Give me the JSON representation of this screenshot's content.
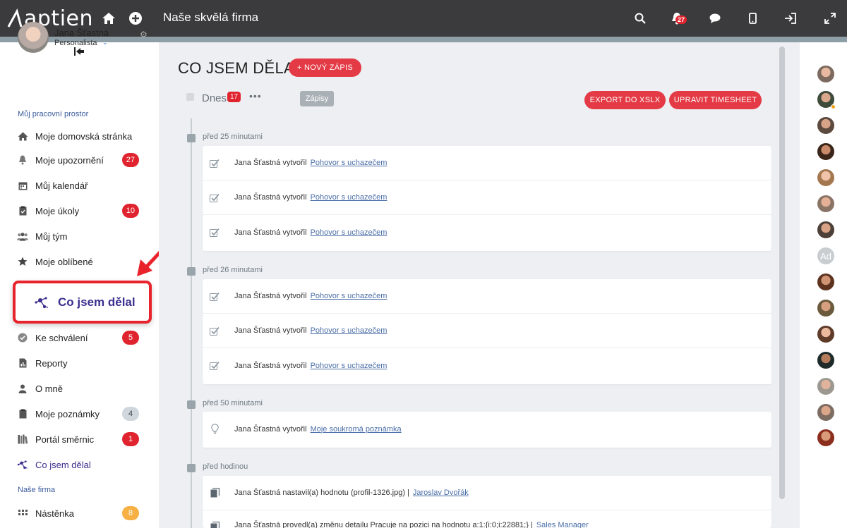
{
  "topbar": {
    "logo_text": "aptien",
    "company_name": "Naše skvělá firma",
    "notification_count": "27",
    "icons": [
      "home-icon",
      "add-icon",
      "search-icon",
      "bell-icon",
      "chat-icon",
      "mobile-icon",
      "logout-icon",
      "fullscreen-icon"
    ]
  },
  "user": {
    "name": "Jana Šťastná",
    "role": "Personalista"
  },
  "sidebar": {
    "section1": "Můj pracovní prostor",
    "items": [
      {
        "label": "Moje domovská stránka",
        "icon": "home-icon"
      },
      {
        "label": "Moje upozornění",
        "icon": "bell-icon",
        "badge": "27"
      },
      {
        "label": "Můj kalendář",
        "icon": "calendar-icon"
      },
      {
        "label": "Moje úkoly",
        "icon": "clipboard-icon",
        "badge": "10"
      },
      {
        "label": "Můj tým",
        "icon": "team-icon"
      },
      {
        "label": "Moje oblíbené",
        "icon": "star-icon"
      },
      {
        "label": "Ke schválení",
        "icon": "check-circle-icon",
        "badge": "5"
      },
      {
        "label": "Reporty",
        "icon": "report-icon"
      },
      {
        "label": "O mně",
        "icon": "person-icon"
      },
      {
        "label": "Moje poznámky",
        "icon": "notes-icon",
        "badge": "4"
      },
      {
        "label": "Portál směrnic",
        "icon": "books-icon",
        "badge": "1"
      },
      {
        "label": "Co jsem dělal",
        "icon": "activity-icon"
      }
    ],
    "section2": "Naše firma",
    "items2": [
      {
        "label": "Nástěnka",
        "icon": "board-icon",
        "badge": "8"
      }
    ]
  },
  "callout": {
    "label": "Co jsem dělal"
  },
  "main": {
    "title": "CO JSEM DĚLAL",
    "new_button": "+ NOVÝ ZÁPIS",
    "day_label": "Dnes",
    "day_count": "17",
    "more": "•••",
    "filter_label": "Zápisy",
    "export_button": "EXPORT DO XSLX",
    "timesheet_button": "UPRAVIT TIMESHEET",
    "groups": [
      {
        "time": "před 25 minutami",
        "rows": [
          {
            "text": "Jana Šťastná vytvořil",
            "link": "Pohovor s uchazečem",
            "icon": "task-check-icon"
          },
          {
            "text": "Jana Šťastná vytvořil",
            "link": "Pohovor s uchazečem",
            "icon": "task-check-icon"
          },
          {
            "text": "Jana Šťastná vytvořil",
            "link": "Pohovor s uchazečem",
            "icon": "task-check-icon"
          }
        ]
      },
      {
        "time": "před 26 minutami",
        "rows": [
          {
            "text": "Jana Šťastná vytvořil",
            "link": "Pohovor s uchazečem",
            "icon": "task-check-icon"
          },
          {
            "text": "Jana Šťastná vytvořil",
            "link": "Pohovor s uchazečem",
            "icon": "task-check-icon"
          },
          {
            "text": "Jana Šťastná vytvořil",
            "link": "Pohovor s uchazečem",
            "icon": "task-check-icon"
          }
        ]
      },
      {
        "time": "před 50 minutami",
        "rows": [
          {
            "text": "Jana Šťastná vytvořil",
            "link": "Moje soukromá poznámka",
            "icon": "lightbulb-icon"
          }
        ]
      },
      {
        "time": "před hodinou",
        "rows": [
          {
            "text": "Jana Šťastná nastavil(a) hodnotu   (profil-1326.jpg) |",
            "link": "Jaroslav Dvořák",
            "icon": "document-icon"
          },
          {
            "text": "Jana Šťastná provedl(a) změnu detailu Pracuje na pozici   na hodnotu  a:1:{i:0;i:22881;} |",
            "link": "Sales Manager",
            "icon": "document-icon"
          }
        ]
      }
    ]
  },
  "rail": {
    "ad_initials": "Ad"
  }
}
